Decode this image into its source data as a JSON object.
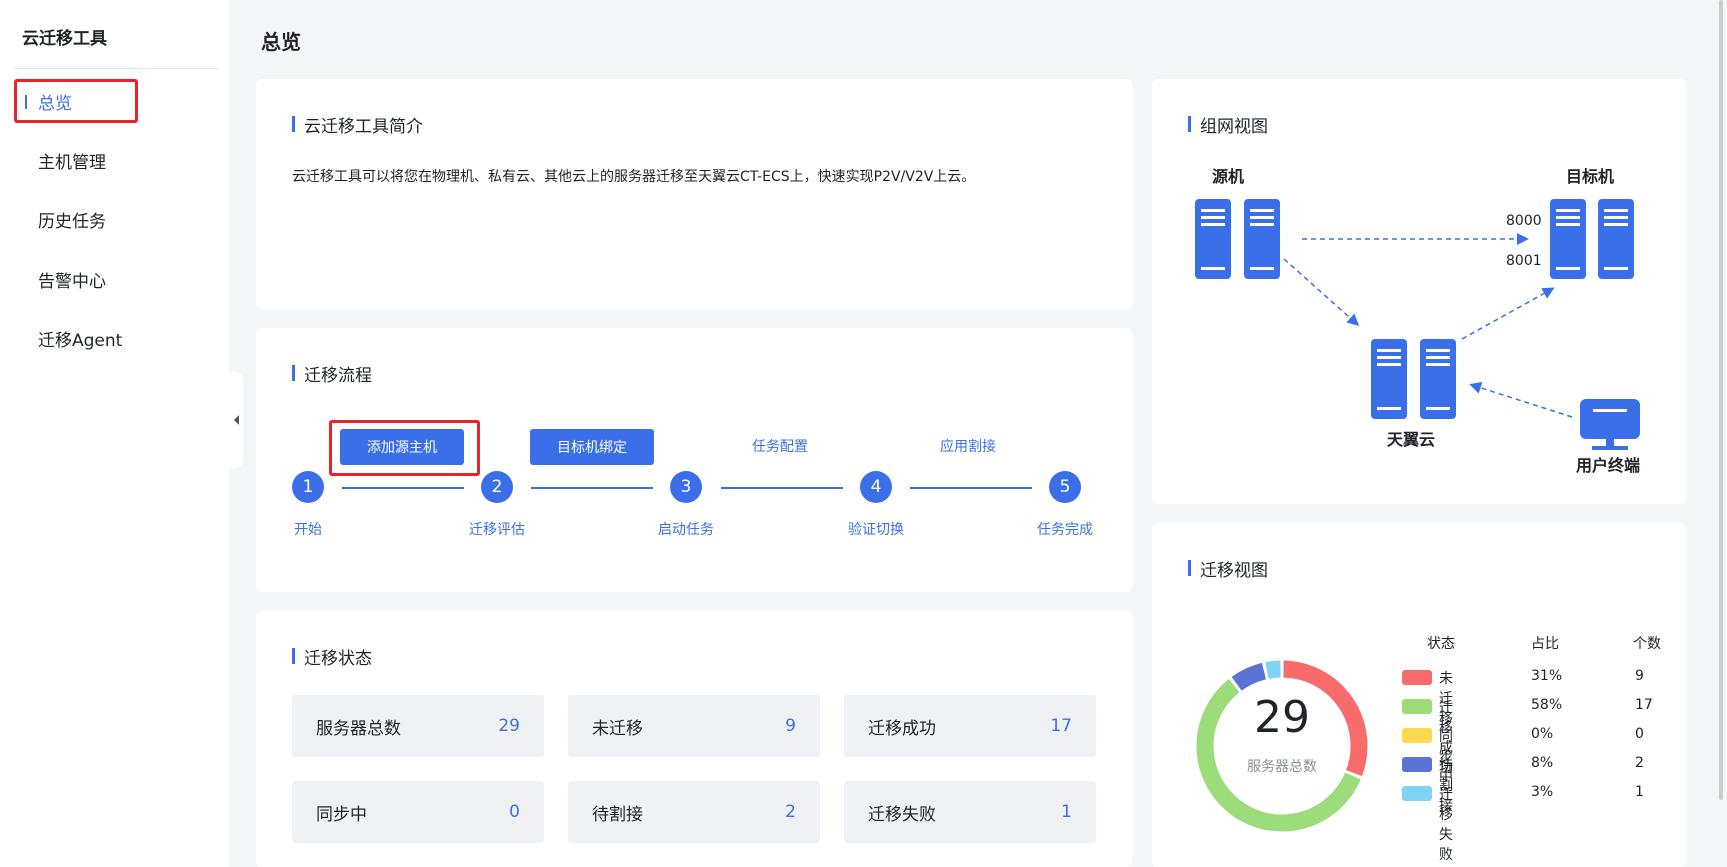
{
  "app": {
    "title": "云迁移工具"
  },
  "sidebar": {
    "items": [
      {
        "label": "总览",
        "active": true
      },
      {
        "label": "主机管理"
      },
      {
        "label": "历史任务"
      },
      {
        "label": "告警中心"
      },
      {
        "label": "迁移Agent"
      }
    ]
  },
  "page": {
    "title": "总览"
  },
  "intro": {
    "title": "云迁移工具简介",
    "text": "云迁移工具可以将您在物理机、私有云、其他云上的服务器迁移至天翼云CT-ECS上，快速实现P2V/V2V上云。"
  },
  "flow": {
    "title": "迁移流程",
    "actions": [
      "添加源主机",
      "目标机绑定",
      "任务配置",
      "应用割接"
    ],
    "steps": [
      {
        "num": "1",
        "label": "开始"
      },
      {
        "num": "2",
        "label": "迁移评估"
      },
      {
        "num": "3",
        "label": "启动任务"
      },
      {
        "num": "4",
        "label": "验证切换"
      },
      {
        "num": "5",
        "label": "任务完成"
      }
    ]
  },
  "status": {
    "title": "迁移状态",
    "items": [
      {
        "label": "服务器总数",
        "value": "29"
      },
      {
        "label": "未迁移",
        "value": "9"
      },
      {
        "label": "迁移成功",
        "value": "17"
      },
      {
        "label": "同步中",
        "value": "0"
      },
      {
        "label": "待割接",
        "value": "2"
      },
      {
        "label": "迁移失败",
        "value": "1"
      }
    ]
  },
  "network": {
    "title": "组网视图",
    "source": "源机",
    "target": "目标机",
    "port1": "8000",
    "port2": "8001",
    "cloud": "天翼云",
    "user": "用户终端"
  },
  "migration_view": {
    "title": "迁移视图",
    "center_value": "29",
    "center_label": "服务器总数",
    "headers": [
      "状态",
      "占比",
      "个数"
    ],
    "rows": [
      {
        "name": "未迁移",
        "pct": "31%",
        "count": "9",
        "color": "#f76b6b"
      },
      {
        "name": "迁移成功",
        "pct": "58%",
        "count": "17",
        "color": "#9ddc7a"
      },
      {
        "name": "同步中",
        "pct": "0%",
        "count": "0",
        "color": "#fdd850"
      },
      {
        "name": "待割接",
        "pct": "8%",
        "count": "2",
        "color": "#5b73d4"
      },
      {
        "name": "迁移失败",
        "pct": "3%",
        "count": "1",
        "color": "#7fd3f5"
      }
    ]
  },
  "chart_data": {
    "type": "pie",
    "categories": [
      "未迁移",
      "迁移成功",
      "同步中",
      "待割接",
      "迁移失败"
    ],
    "values": [
      9,
      17,
      0,
      2,
      1
    ],
    "title": ""
  }
}
